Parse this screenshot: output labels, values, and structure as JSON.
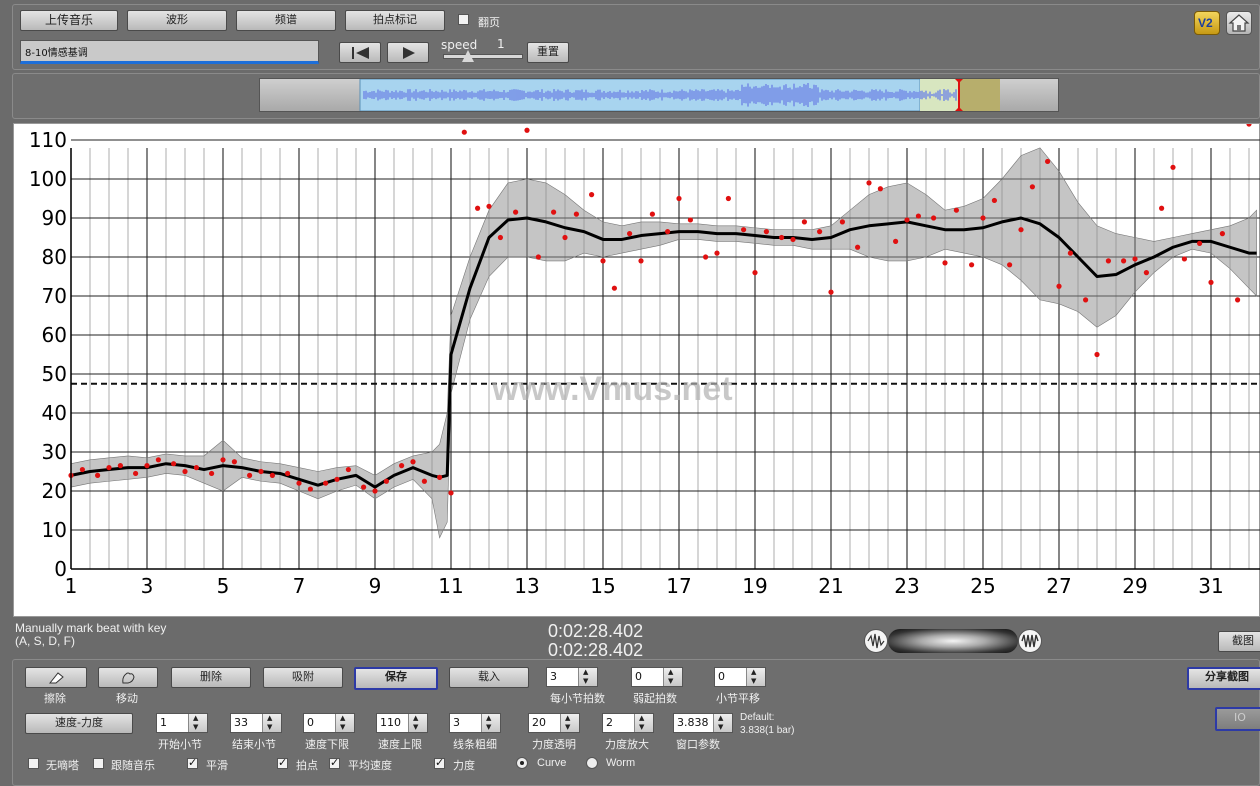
{
  "toolbar": {
    "upload_label": "上传音乐",
    "waveform_label": "波形",
    "spectrum_label": "频谱",
    "beat_mark_label": "拍点标记",
    "page_turn_label": "翻页",
    "page_turn_checked": false,
    "song_title_value": "8-10情感基调",
    "speed_label": "speed",
    "speed_value": "1",
    "reset_label": "重置",
    "version_badge": "V2",
    "home_icon": "home-icon"
  },
  "chart_data": {
    "type": "line",
    "title": "",
    "xlabel": "",
    "ylabel": "",
    "xlim": [
      1,
      32.2
    ],
    "ylim": [
      0,
      115
    ],
    "x_ticks": [
      1,
      3,
      5,
      7,
      9,
      11,
      13,
      15,
      17,
      19,
      21,
      23,
      25,
      27,
      29,
      31
    ],
    "y_ticks": [
      0,
      10,
      20,
      30,
      40,
      50,
      60,
      70,
      80,
      90,
      100,
      110
    ],
    "threshold": 47.5,
    "grid": true,
    "watermark": "www.Vmus.net",
    "curve": {
      "x": [
        1,
        1.5,
        2,
        2.5,
        3,
        3.5,
        4,
        4.5,
        5,
        5.5,
        6,
        6.5,
        7,
        7.5,
        8,
        8.5,
        9,
        9.5,
        10,
        10.5,
        10.7,
        10.9,
        11,
        11.5,
        12,
        12.5,
        13,
        13.5,
        14,
        14.5,
        15,
        15.5,
        16,
        16.5,
        17,
        17.5,
        18,
        18.5,
        19,
        19.5,
        20,
        20.5,
        21,
        21.5,
        22,
        22.5,
        23,
        23.5,
        24,
        24.5,
        25,
        25.5,
        26,
        26.5,
        27,
        27.5,
        28,
        28.5,
        29,
        29.5,
        30,
        30.5,
        31,
        31.5,
        32,
        32.2
      ],
      "y": [
        24,
        25,
        25.5,
        26,
        26,
        27,
        26.5,
        25.5,
        26.5,
        26,
        25,
        24.5,
        23,
        21.5,
        23,
        24,
        21,
        24,
        26,
        24,
        23.5,
        24,
        55,
        72,
        85,
        89.5,
        90,
        89,
        87.5,
        86.5,
        84.5,
        84.5,
        85.5,
        86,
        86.5,
        86.5,
        86,
        86,
        85.5,
        85,
        85,
        84.5,
        85,
        87,
        88,
        88.5,
        89,
        88,
        87,
        87,
        87.5,
        89,
        90,
        88.5,
        85,
        80,
        75,
        75.5,
        78,
        80,
        82.5,
        84,
        84,
        82.5,
        81,
        81
      ]
    },
    "band_upper": {
      "x": [
        1,
        1.5,
        2,
        2.5,
        3,
        3.5,
        4,
        4.5,
        5,
        5.5,
        6,
        6.5,
        7,
        7.5,
        8,
        8.5,
        9,
        9.5,
        10,
        10.5,
        10.7,
        10.9,
        11,
        11.5,
        12,
        12.5,
        13,
        13.5,
        14,
        14.5,
        15,
        15.5,
        16,
        16.5,
        17,
        17.5,
        18,
        18.5,
        19,
        19.5,
        20,
        20.5,
        21,
        21.5,
        22,
        22.5,
        23,
        23.5,
        24,
        24.5,
        25,
        25.5,
        26,
        26.5,
        27,
        27.5,
        28,
        28.5,
        29,
        29.5,
        30,
        30.5,
        31,
        31.5,
        32,
        32.2
      ],
      "y": [
        27,
        28,
        28.5,
        29,
        28.5,
        29.5,
        29,
        29,
        33,
        28.5,
        27.5,
        27,
        26,
        25,
        26,
        26.5,
        24,
        27,
        29,
        30,
        32,
        40,
        65,
        80,
        92,
        99,
        100,
        99,
        96,
        92,
        89,
        88,
        89,
        89,
        88.5,
        88.5,
        88,
        88,
        87.5,
        87,
        87,
        87,
        88,
        92,
        96,
        98,
        99,
        96,
        92,
        93,
        95,
        100,
        106,
        108,
        102,
        94,
        88,
        86,
        85,
        84,
        85,
        86,
        87,
        88,
        90,
        92
      ]
    },
    "band_lower": {
      "x": [
        1,
        1.5,
        2,
        2.5,
        3,
        3.5,
        4,
        4.5,
        5,
        5.5,
        6,
        6.5,
        7,
        7.5,
        8,
        8.5,
        9,
        9.5,
        10,
        10.5,
        10.7,
        10.9,
        11,
        11.5,
        12,
        12.5,
        13,
        13.5,
        14,
        14.5,
        15,
        15.5,
        16,
        16.5,
        17,
        17.5,
        18,
        18.5,
        19,
        19.5,
        20,
        20.5,
        21,
        21.5,
        22,
        22.5,
        23,
        23.5,
        24,
        24.5,
        25,
        25.5,
        26,
        26.5,
        27,
        27.5,
        28,
        28.5,
        29,
        29.5,
        30,
        30.5,
        31,
        31.5,
        32,
        32.2
      ],
      "y": [
        21,
        22,
        22.5,
        23,
        23.5,
        24.5,
        24,
        22,
        20,
        23.5,
        22.5,
        22,
        20,
        18,
        20,
        21.5,
        18,
        21,
        23,
        18,
        8,
        12,
        45,
        64,
        75,
        80,
        80,
        79,
        79,
        81,
        80,
        81,
        82,
        83,
        84.5,
        84.5,
        84,
        84,
        83.5,
        83,
        83,
        82,
        82,
        82,
        80,
        79,
        79,
        80,
        82,
        81,
        80,
        78,
        74,
        69,
        68,
        66,
        62,
        65,
        71,
        76,
        80,
        82,
        81,
        77,
        72,
        70
      ]
    },
    "points": {
      "x": [
        1,
        1.3,
        1.7,
        2.0,
        2.3,
        2.7,
        3.0,
        3.3,
        3.7,
        4.0,
        4.3,
        4.7,
        5.0,
        5.3,
        5.7,
        6.0,
        6.3,
        6.7,
        7.0,
        7.3,
        7.7,
        8.0,
        8.3,
        8.7,
        9.0,
        9.3,
        9.7,
        10.0,
        10.3,
        10.7,
        11.0,
        11.35,
        11.7,
        12.0,
        12.3,
        12.7,
        13.0,
        13.3,
        13.7,
        14.0,
        14.3,
        14.7,
        15.0,
        15.3,
        15.7,
        16.0,
        16.3,
        16.7,
        17.0,
        17.3,
        17.7,
        18.0,
        18.3,
        18.7,
        19.0,
        19.3,
        19.7,
        20.0,
        20.3,
        20.7,
        21.0,
        21.3,
        21.7,
        22.0,
        22.3,
        22.7,
        23.0,
        23.3,
        23.7,
        24.0,
        24.3,
        24.7,
        25.0,
        25.3,
        25.7,
        26.0,
        26.3,
        26.7,
        27.0,
        27.3,
        27.7,
        28.0,
        28.3,
        28.7,
        29.0,
        29.3,
        29.7,
        30.0,
        30.3,
        30.7,
        31.0,
        31.3,
        31.7,
        32.0
      ],
      "y": [
        24,
        25.5,
        24,
        26,
        26.5,
        24.5,
        26.5,
        28,
        27,
        25,
        26,
        24.5,
        28,
        27.5,
        24,
        25,
        24,
        24.5,
        22,
        20.5,
        22,
        23,
        25.5,
        21,
        20,
        22.5,
        26.5,
        27.5,
        22.5,
        23.5,
        19.5,
        112,
        92.5,
        93,
        85,
        91.5,
        112.5,
        80,
        91.5,
        85,
        91,
        96,
        79,
        72,
        86,
        79,
        91,
        86.5,
        95,
        89.5,
        80,
        81,
        95,
        87,
        76,
        86.5,
        85,
        84.5,
        89,
        86.5,
        71,
        89,
        82.5,
        99,
        97.5,
        84,
        89.5,
        90.5,
        90,
        78.5,
        92,
        78,
        90,
        94.5,
        78,
        87,
        98,
        104.5,
        72.5,
        81,
        69,
        55,
        79,
        79,
        79.5,
        76,
        92.5,
        103,
        79.5,
        83.5,
        73.5,
        86,
        69
      ]
    }
  },
  "waveform_nav": {
    "label": "waveform-overview"
  },
  "status": {
    "hint_line1": "Manually mark beat with key",
    "hint_line2": "(A, S, D, F)",
    "time_current": "0:02:28.402",
    "time_total": "0:02:28.402",
    "cut_label": "截图"
  },
  "controls": {
    "erase_label": "擦除",
    "move_label": "移动",
    "delete_label": "删除",
    "snap_label": "吸附",
    "save_label": "保存",
    "import_label": "载入",
    "beats_per_bar_value": "3",
    "beats_per_bar_label": "每小节拍数",
    "upbeat_value": "0",
    "upbeat_label": "弱起拍数",
    "bar_shift_value": "0",
    "bar_shift_label": "小节平移",
    "share_label": "分享截图",
    "io_label": "IO",
    "tempo_dynamics_label": "速度-力度",
    "start_bar_value": "1",
    "start_bar_label": "开始小节",
    "end_bar_value": "33",
    "end_bar_label": "结束小节",
    "tempo_min_value": "0",
    "tempo_min_label": "速度下限",
    "tempo_max_value": "110",
    "tempo_max_label": "速度上限",
    "line_width_value": "3",
    "line_width_label": "线条粗细",
    "dynamics_opacity_value": "20",
    "dynamics_opacity_label": "力度透明",
    "dynamics_scale_value": "2",
    "dynamics_scale_label": "力度放大",
    "window_param_value": "3.838",
    "window_param_label": "窗口参数",
    "default_label": "Default:",
    "default_value": "3.838(1 bar)",
    "metronome_label": "无嘀嗒",
    "follow_music_label": "跟随音乐",
    "smooth_label": "平滑",
    "beat_points_label": "拍点",
    "avg_tempo_label": "平均速度",
    "dynamics_label": "力度",
    "curve_label": "Curve",
    "worm_label": "Worm"
  }
}
